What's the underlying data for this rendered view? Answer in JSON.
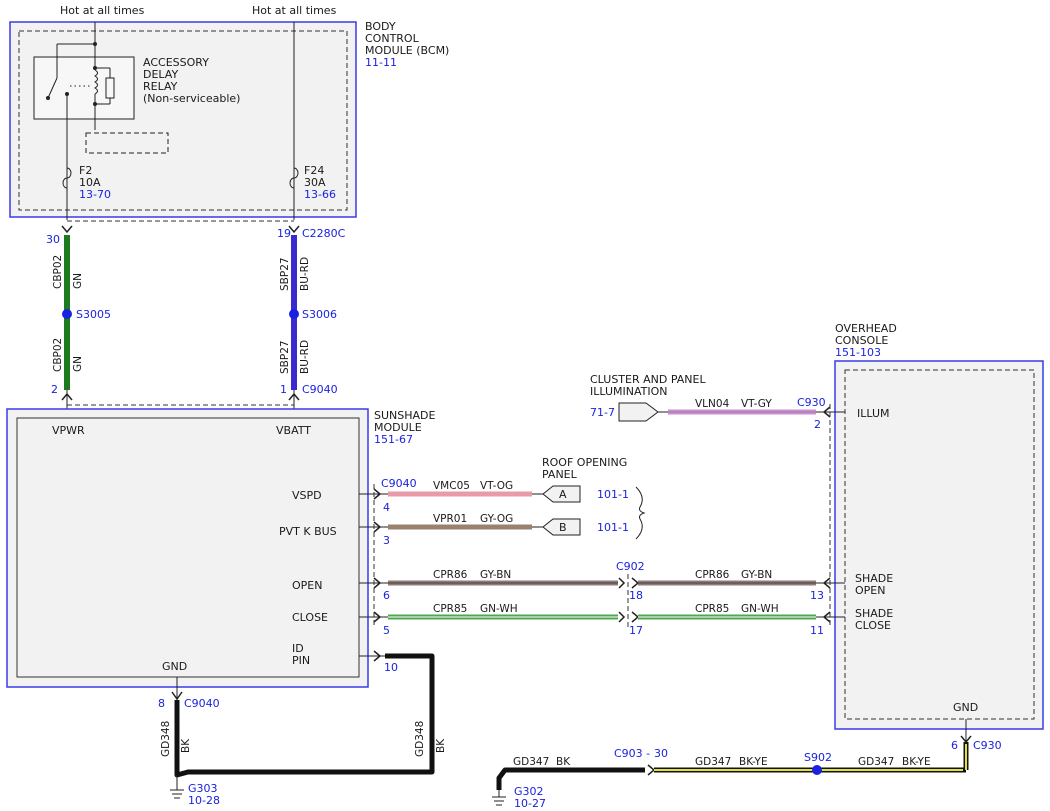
{
  "sources": {
    "left": "Hot at all times",
    "right": "Hot at all times"
  },
  "bcm": {
    "name_lines": [
      "BODY",
      "CONTROL",
      "MODULE (BCM)"
    ],
    "ref": "11-11"
  },
  "relay": {
    "lines": [
      "ACCESSORY",
      "DELAY",
      "RELAY",
      "(Non-serviceable)"
    ]
  },
  "fuses": [
    {
      "name": "F2",
      "rating": "10A",
      "ref": "13-70"
    },
    {
      "name": "F24",
      "rating": "30A",
      "ref": "13-66"
    }
  ],
  "upper_pins": {
    "left": "30",
    "right": "19",
    "connector": "C2280C"
  },
  "vertical_wires": [
    {
      "circuit": "CBP02",
      "color": "GN"
    },
    {
      "circuit": "SBP27",
      "color": "BU-RD"
    }
  ],
  "splices": {
    "left": "S3005",
    "right": "S3006",
    "s902": "S902"
  },
  "lower_pins": {
    "left": "2",
    "right": "1",
    "connector": "C9040"
  },
  "sunshade": {
    "name_lines": [
      "SUNSHADE",
      "MODULE"
    ],
    "ref": "151-67",
    "vpwr": "VPWR",
    "vbatt": "VBATT",
    "gnd": "GND",
    "terminals": [
      "VSPD",
      "PVT K BUS",
      "OPEN",
      "CLOSE"
    ],
    "id_pin": [
      "ID",
      "PIN"
    ]
  },
  "roof_panel": {
    "lines": [
      "ROOF OPENING",
      "PANEL"
    ]
  },
  "signals": [
    {
      "connector": "C9040",
      "pin": "4",
      "circuit": "VMC05",
      "color": "VT-OG",
      "tag": "A",
      "ref": "101-1"
    },
    {
      "pin": "3",
      "circuit": "VPR01",
      "color": "GY-OG",
      "tag": "B",
      "ref": "101-1"
    }
  ],
  "motor_wires": [
    {
      "pin_left": "6",
      "circuit": "CPR86",
      "color": "GY-BN",
      "pin_mid": "18",
      "pin_right": "13"
    },
    {
      "pin_left": "5",
      "circuit": "CPR85",
      "color": "GN-WH",
      "pin_mid": "17",
      "pin_right": "11"
    }
  ],
  "c902": "C902",
  "id_pin_number": "10",
  "cluster": {
    "lines": [
      "CLUSTER AND PANEL",
      "ILLUMINATION"
    ],
    "ref": "71-7",
    "circuit": "VLN04",
    "color": "VT-GY",
    "connector": "C930",
    "pin": "2"
  },
  "overhead": {
    "name_lines": [
      "OVERHEAD",
      "CONSOLE"
    ],
    "ref": "151-103",
    "illum": "ILLUM",
    "shade_open": [
      "SHADE",
      "OPEN"
    ],
    "shade_close": [
      "SHADE",
      "CLOSE"
    ],
    "gnd": "GND",
    "gnd_pin": "6",
    "gnd_connector": "C930"
  },
  "ground_left": {
    "pin": "8",
    "connector": "C9040",
    "circuit": "GD348",
    "color": "BK",
    "ground": "G303",
    "ref": "10-28"
  },
  "id_wire": {
    "circuit": "GD348",
    "color": "BK"
  },
  "ground_right": {
    "ground": "G302",
    "ref": "10-27",
    "seg1_circuit": "GD347",
    "seg1_color": "BK",
    "connector": "C903 -",
    "pin": "30",
    "seg2_circuit": "GD347",
    "seg2_color": "BK-YE",
    "seg3_circuit": "GD347",
    "seg3_color": "BK-YE"
  },
  "colors": {
    "module_stroke": "#3a3ae8",
    "module_fill": "#f2f2f2",
    "ref_text": "#1a22e0",
    "GN": "#1e7a1e",
    "BU-RD": "#3a2ad0",
    "VT-OG": "#e89aa8",
    "GY-OG": "#9a8270",
    "GY-BN": "#8f7a78",
    "GN-WH": "#4fa84f",
    "VT-GY": "#d08ad8",
    "BK": "#111111",
    "BK-YE": "#e0e040"
  }
}
